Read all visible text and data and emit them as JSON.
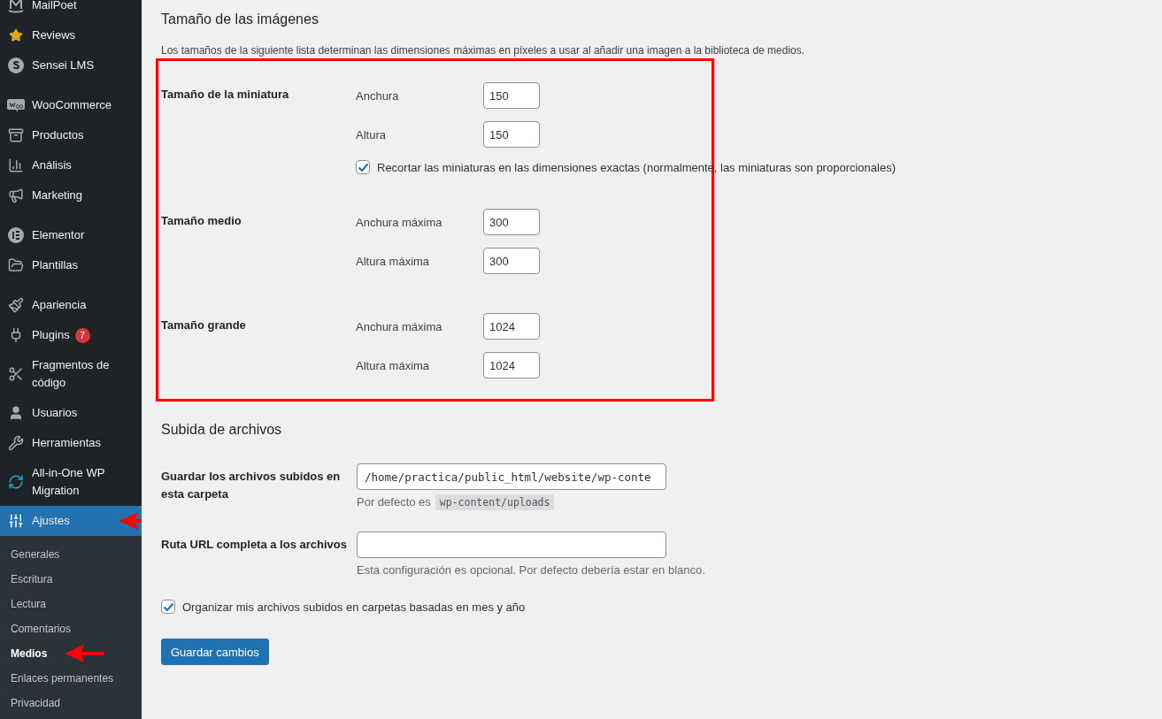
{
  "sidebar": {
    "groups": [
      [
        {
          "label": "MailPoet"
        },
        {
          "label": "Reviews"
        },
        {
          "label": "Sensei LMS"
        }
      ],
      [
        {
          "label": "WooCommerce"
        },
        {
          "label": "Productos"
        },
        {
          "label": "Análisis"
        },
        {
          "label": "Marketing"
        }
      ],
      [
        {
          "label": "Elementor"
        },
        {
          "label": "Plantillas"
        }
      ],
      [
        {
          "label": "Apariencia",
          "selected": false
        },
        {
          "label": "Plugins",
          "badge": "7",
          "selected": false
        },
        {
          "label": "Fragmentos de código",
          "selected": false
        },
        {
          "label": "Usuarios",
          "selected": false
        },
        {
          "label": "Herramientas",
          "selected": false
        },
        {
          "label": "All-in-One WP Migration",
          "selected": false
        },
        {
          "label": "Ajustes",
          "selected": true
        }
      ]
    ],
    "submenu": [
      {
        "label": "Generales",
        "selected": false
      },
      {
        "label": "Escritura",
        "selected": false
      },
      {
        "label": "Lectura",
        "selected": false
      },
      {
        "label": "Comentarios",
        "selected": false
      },
      {
        "label": "Medios",
        "selected": true
      },
      {
        "label": "Enlaces permanentes",
        "selected": false
      },
      {
        "label": "Privacidad",
        "selected": false
      }
    ]
  },
  "image_sizes": {
    "title": "Tamaño de las imágenes",
    "description": "Los tamaños de la siguiente lista determinan las dimensiones máximas en píxeles a usar al añadir una imagen a la biblioteca de medios.",
    "groups": [
      {
        "label": "Tamaño de la miniatura",
        "fields": [
          {
            "label": "Anchura",
            "value": "150"
          },
          {
            "label": "Altura",
            "value": "150"
          }
        ],
        "checkbox": {
          "label": "Recortar las miniaturas en las dimensiones exactas (normalmente, las miniaturas son proporcionales)",
          "checked": true
        }
      },
      {
        "label": "Tamaño medio",
        "fields": [
          {
            "label": "Anchura máxima",
            "value": "300"
          },
          {
            "label": "Altura máxima",
            "value": "300"
          }
        ]
      },
      {
        "label": "Tamaño grande",
        "fields": [
          {
            "label": "Anchura máxima",
            "value": "1024"
          },
          {
            "label": "Altura máxima",
            "value": "1024"
          }
        ]
      }
    ]
  },
  "uploads": {
    "title": "Subida de archivos",
    "rows": [
      {
        "label": "Guardar los archivos subidos en esta carpeta",
        "value": "/home/practica/public_html/website/wp-conte",
        "hint": "Por defecto es",
        "hint_code": "wp-content/uploads"
      },
      {
        "label": "Ruta URL completa a los archivos",
        "hint": "Esta configuración es opcional. Por defecto debería estar en blanco."
      }
    ],
    "checkbox": {
      "label": "Organizar mis archivos subidos en carpetas basadas en mes y año",
      "checked": true
    }
  },
  "save_button": "Guardar cambios"
}
